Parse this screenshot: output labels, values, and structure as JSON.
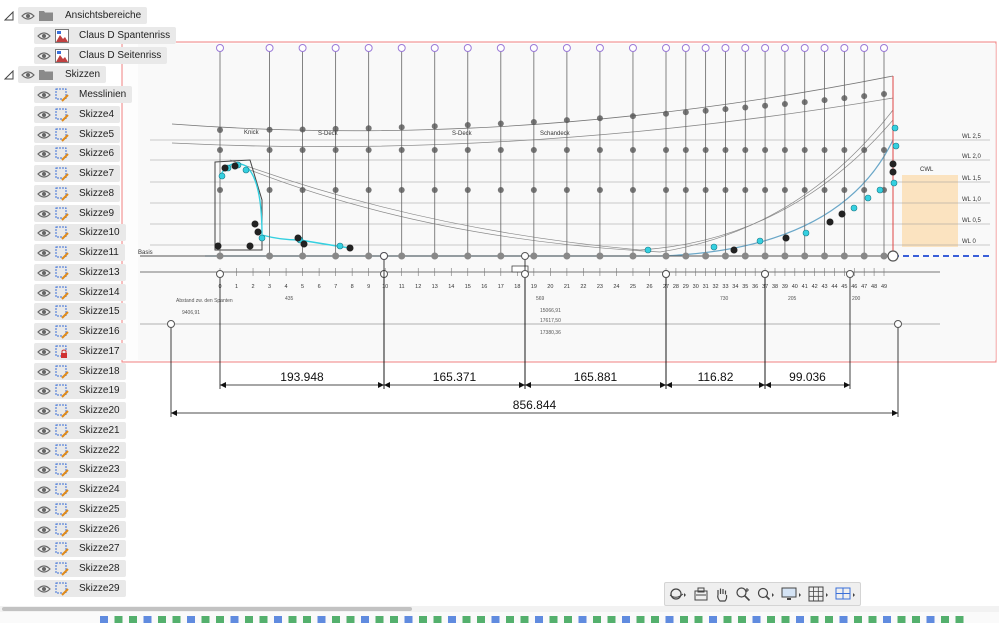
{
  "browser": {
    "groups": [
      {
        "label": "Ansichtsbereiche",
        "icon": "folder-icon",
        "children": [
          {
            "label": "Claus D Spantenriss",
            "icon": "canvas-image-icon"
          },
          {
            "label": "Claus D Seitenriss",
            "icon": "canvas-image-icon"
          }
        ]
      },
      {
        "label": "Skizzen",
        "icon": "folder-icon",
        "children": [
          {
            "label": "Messlinien",
            "icon": "sketch-icon"
          },
          {
            "label": "Skizze4",
            "icon": "sketch-icon"
          },
          {
            "label": "Skizze5",
            "icon": "sketch-icon"
          },
          {
            "label": "Skizze6",
            "icon": "sketch-icon"
          },
          {
            "label": "Skizze7",
            "icon": "sketch-icon"
          },
          {
            "label": "Skizze8",
            "icon": "sketch-icon"
          },
          {
            "label": "Skizze9",
            "icon": "sketch-icon"
          },
          {
            "label": "Skizze10",
            "icon": "sketch-icon"
          },
          {
            "label": "Skizze11",
            "icon": "sketch-icon"
          },
          {
            "label": "Skizze13",
            "icon": "sketch-icon"
          },
          {
            "label": "Skizze14",
            "icon": "sketch-icon"
          },
          {
            "label": "Skizze15",
            "icon": "sketch-icon"
          },
          {
            "label": "Skizze16",
            "icon": "sketch-icon"
          },
          {
            "label": "Skizze17",
            "icon": "sketch-locked-icon"
          },
          {
            "label": "Skizze18",
            "icon": "sketch-icon"
          },
          {
            "label": "Skizze19",
            "icon": "sketch-icon"
          },
          {
            "label": "Skizze20",
            "icon": "sketch-icon"
          },
          {
            "label": "Skizze21",
            "icon": "sketch-icon"
          },
          {
            "label": "Skizze22",
            "icon": "sketch-icon"
          },
          {
            "label": "Skizze23",
            "icon": "sketch-icon"
          },
          {
            "label": "Skizze24",
            "icon": "sketch-icon"
          },
          {
            "label": "Skizze25",
            "icon": "sketch-icon"
          },
          {
            "label": "Skizze26",
            "icon": "sketch-icon"
          },
          {
            "label": "Skizze27",
            "icon": "sketch-icon"
          },
          {
            "label": "Skizze28",
            "icon": "sketch-icon"
          },
          {
            "label": "Skizze29",
            "icon": "sketch-icon"
          }
        ]
      }
    ]
  },
  "drawing": {
    "frame_labels": [
      "0",
      "1",
      "2",
      "3",
      "4",
      "5",
      "6",
      "7",
      "8",
      "9",
      "10",
      "11",
      "12",
      "13",
      "14",
      "15",
      "16",
      "17",
      "18",
      "19",
      "20",
      "21",
      "22",
      "23",
      "24",
      "25",
      "26",
      "27",
      "28",
      "29",
      "30",
      "31",
      "32",
      "33",
      "34",
      "35",
      "36",
      "37",
      "38",
      "39",
      "40",
      "41",
      "42",
      "43",
      "44",
      "45",
      "46",
      "47",
      "48",
      "49"
    ],
    "waterlines": [
      "WL 2,5",
      "WL 2,0",
      "WL 1,5",
      "WL 1,0",
      "WL 0,5",
      "WL 0"
    ],
    "annotations": {
      "knick": "Knick",
      "sdeck1": "S-Deck",
      "sdeck2": "S-Deck",
      "schandeck": "Schandeck",
      "cwl": "CWL",
      "basis": "Basis",
      "abstand": "Abstand zw. den Spanten",
      "dim_435": "435",
      "dim_569": "569",
      "dim_730": "730",
      "dim_205": "205",
      "dim_200": "200",
      "dim_9406": "9406,91",
      "dim_15066": "15066,91",
      "dim_17617": "17617,50",
      "dim_17380": "17380,36"
    },
    "dimensions": [
      {
        "value": "193.948"
      },
      {
        "value": "165.371"
      },
      {
        "value": "165.881"
      },
      {
        "value": "116.82"
      },
      {
        "value": "99.036"
      },
      {
        "value": "856.844"
      }
    ]
  },
  "navbar": {
    "buttons": [
      {
        "icon": "orbit-icon"
      },
      {
        "icon": "look-at-icon"
      },
      {
        "icon": "pan-hand-icon"
      },
      {
        "icon": "zoom-icon"
      },
      {
        "icon": "fit-window-icon"
      },
      {
        "icon": "display-settings-icon"
      },
      {
        "icon": "grid-icon"
      },
      {
        "icon": "viewports-icon"
      }
    ]
  },
  "colors": {
    "canvas_border": "#f08080",
    "dim_line": "#111111",
    "station_line": "#555555",
    "cyan_point": "#35d0e0",
    "purple_point": "#9b7ad8",
    "sketch_line": "#6aa7c8",
    "wl_highlight": "#fbe3c0",
    "blue_dash": "#3a5fd8"
  }
}
